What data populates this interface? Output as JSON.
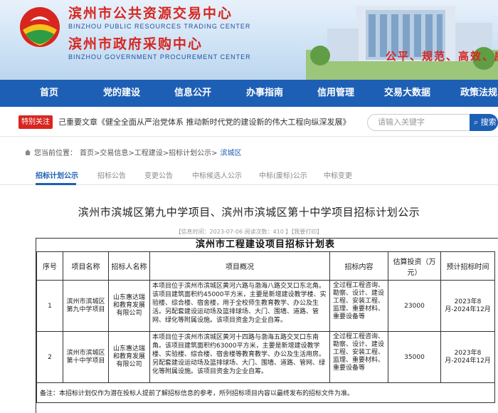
{
  "header": {
    "org_cn_1": "滨州市公共资源交易中心",
    "org_en_1": "BINZHOU PUBLIC RESOURCES TRADING CENTER",
    "org_cn_2": "滨州市政府采购中心",
    "org_en_2": "BINZHOU GOVERNMENT PROCUREMENT CENTER",
    "slogan": "公平、规范、高效、廉"
  },
  "nav": [
    "首页",
    "党的建设",
    "信息公开",
    "办事指南",
    "信用管理",
    "交易大数据",
    "政策法规"
  ],
  "notice": {
    "tag": "特别关注",
    "ticker": "己重要文章《健全全面从严治党体系 推动新时代党的建设新的伟大工程向纵深发展》",
    "search_placeholder": "请输入关键字",
    "search_button": "搜索"
  },
  "breadcrumb": {
    "prefix": "您当前位置：",
    "path": "首页>交易信息>工程建设>招标计划公示>",
    "current": "滨城区"
  },
  "tabs": [
    "招标计划公示",
    "招标公告",
    "变更公告",
    "中标候选人公示",
    "中标(废标)公示",
    "中标变更"
  ],
  "article": {
    "title": "滨州市滨城区第九中学项目、滨州市滨城区第十中学项目招标计划公示",
    "meta": "【信息时间：2023-07-06  阅读次数：410 】【我要打印】"
  },
  "doc": {
    "title": "滨州市工程建设项目招标计划表",
    "headers": [
      "序号",
      "项目名称",
      "招标人名称",
      "项目概况",
      "招标内容",
      "估算投资（万元）",
      "预计招标时间"
    ],
    "rows": [
      {
        "no": "1",
        "name": "滨州市滨城区第九中学项目",
        "tenderer": "山东惠达瑞和教育发展有限公司",
        "desc": "本项目位于滨州市滨城区黄河六路与渤海八路交叉口东北角。该项目建筑面积约45000平方米，主要是新增建设教学楼、实验楼、综合楼、宿舍楼，用于全校师生教育教学、办公及生活。另配套建设运动场及篮排球场、大门、围墙、道路、管网、绿化等附属设施。该项目资金为企业自筹。",
        "content": "全过程工程咨询、勘察、设计、建设工程、安装工程、监理、重要材料、重要设备等",
        "investment": "23000",
        "time": "2023年8月-2024年12月"
      },
      {
        "no": "2",
        "name": "滨州市滨城区第十中学项目",
        "tenderer": "山东惠达瑞和教育发展有限公司",
        "desc": "本项目位于滨州市滨城区黄河十四路与渤海五路交叉口东南角。该项目建筑面积约63000平方米，主要是新增建设教学楼、实验楼、综合楼、宿舍楼等教育教学、办公及生活用房。另配套建设运动场及篮排球场、大门、围墙、道路、管网、绿化等附属设施。该项目资金为企业自筹。",
        "content": "全过程工程咨询、勘察、设计、建设工程、安装工程、监理、重要材料、重要设备等",
        "investment": "35000",
        "time": "2023年8月-2024年12月"
      }
    ],
    "note": "备注：本招标计划仅作为潜在投标人提前了解招标信息的参考，所列招标项目内容以最终发布的招标文件为准。"
  },
  "colors": {
    "nav": "#1d5fb5",
    "accent_red": "#d7261f"
  }
}
